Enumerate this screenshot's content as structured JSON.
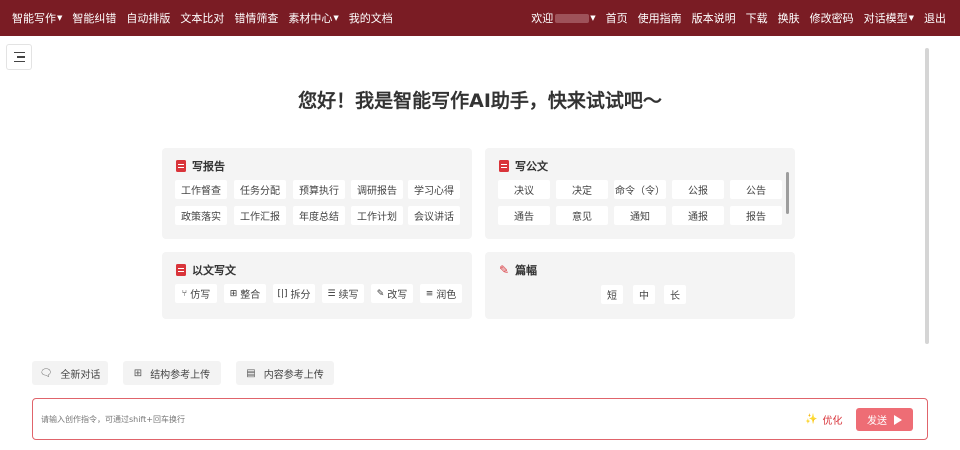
{
  "nav": {
    "left": [
      {
        "label": "智能写作",
        "dropdown": true
      },
      {
        "label": "智能纠错",
        "dropdown": false
      },
      {
        "label": "自动排版",
        "dropdown": false
      },
      {
        "label": "文本比对",
        "dropdown": false
      },
      {
        "label": "错情筛查",
        "dropdown": false
      },
      {
        "label": "素材中心",
        "dropdown": true
      },
      {
        "label": "我的文档",
        "dropdown": false
      }
    ],
    "welcome": "欢迎",
    "right": [
      {
        "label": "首页"
      },
      {
        "label": "使用指南"
      },
      {
        "label": "版本说明"
      },
      {
        "label": "下载"
      },
      {
        "label": "换肤"
      },
      {
        "label": "修改密码"
      },
      {
        "label": "对话模型",
        "dropdown": true
      },
      {
        "label": "退出"
      }
    ]
  },
  "headline": "您好！我是智能写作AI助手，快来试试吧～",
  "report": {
    "title": "写报告",
    "items": [
      "工作督查",
      "任务分配",
      "预算执行",
      "调研报告",
      "学习心得",
      "政策落实",
      "工作汇报",
      "年度总结",
      "工作计划",
      "会议讲话"
    ]
  },
  "official": {
    "title": "写公文",
    "items": [
      "决议",
      "决定",
      "命令（令）",
      "公报",
      "公告",
      "通告",
      "意见",
      "通知",
      "通报",
      "报告"
    ]
  },
  "rewrite": {
    "title": "以文写文",
    "items": [
      {
        "label": "仿写",
        "icon": "imitate-icon"
      },
      {
        "label": "整合",
        "icon": "merge-icon"
      },
      {
        "label": "拆分",
        "icon": "split-icon"
      },
      {
        "label": "续写",
        "icon": "continue-icon"
      },
      {
        "label": "改写",
        "icon": "rewrite-icon"
      },
      {
        "label": "润色",
        "icon": "polish-icon"
      }
    ]
  },
  "length": {
    "title": "篇幅",
    "items": [
      "短",
      "中",
      "长"
    ]
  },
  "actions": {
    "new_chat": "全新对话",
    "structure_upload": "结构参考上传",
    "content_upload": "内容参考上传"
  },
  "input": {
    "placeholder": "请输入创作指令，可通过shift+回车换行",
    "optimize": "优化",
    "send": "发送"
  },
  "colors": {
    "nav_bg": "#7a1c24",
    "accent": "#d9343a",
    "send_bg": "#ee6d75"
  }
}
